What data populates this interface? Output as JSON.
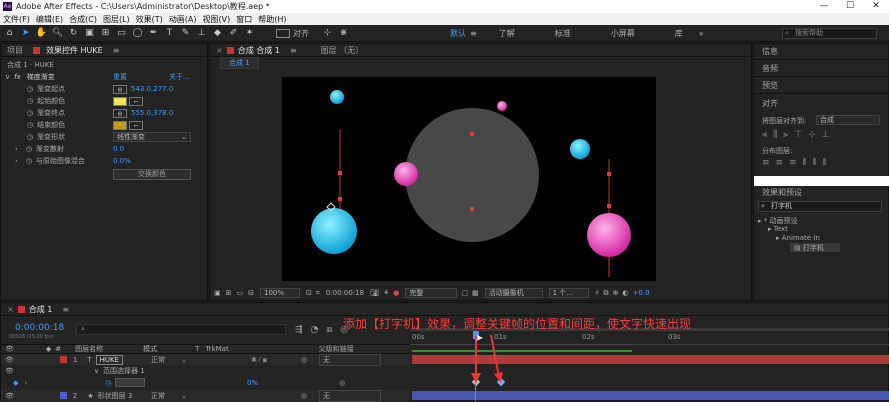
{
  "app": {
    "title": "Adobe After Effects - C:\\Users\\Administrator\\Desktop\\教程.aep *",
    "logo_text": "Ae"
  },
  "window_controls": [
    "—",
    "☐",
    "✕"
  ],
  "menu": [
    "文件(F)",
    "编辑(E)",
    "合成(C)",
    "图层(L)",
    "效果(T)",
    "动画(A)",
    "视图(V)",
    "窗口",
    "帮助(H)"
  ],
  "toolbar": {
    "align_label": "对齐",
    "workspaces": [
      "默认",
      "了解",
      "标准",
      "小屏幕",
      "库"
    ],
    "active_workspace": "默认",
    "search_placeholder": "搜索帮助"
  },
  "left_panel": {
    "tabs": [
      "项目",
      "效果控件 HUKE"
    ],
    "active_tab": "效果控件 HUKE",
    "breadcrumb": "合成 1 · HUKE",
    "effect": {
      "name": "梯度渐变",
      "reset": "重置",
      "about": "关于..."
    },
    "props": [
      {
        "label": "渐变起点",
        "value": "543.0,277.0",
        "kind": "point"
      },
      {
        "label": "起始颜色",
        "value": "",
        "kind": "color",
        "color": "#f6e05a"
      },
      {
        "label": "渐变终点",
        "value": "555.0,378.0",
        "kind": "point"
      },
      {
        "label": "结束颜色",
        "value": "",
        "kind": "color",
        "color": "#c89a20"
      },
      {
        "label": "渐变形状",
        "value": "线性渐变",
        "kind": "dropdown"
      },
      {
        "label": "渐变散射",
        "value": "0.0",
        "kind": "number"
      },
      {
        "label": "与原始图像混合",
        "value": "0.0%",
        "kind": "number"
      }
    ],
    "swap_button": "交换颜色"
  },
  "comp_panel": {
    "tabs": [
      "合成 合成 1",
      "图层 （无）"
    ],
    "crumb": "合成 1",
    "zoom": "100%",
    "timecode": "0:00:00:18",
    "quality": "完整",
    "camera": "活动摄像机",
    "views": "1 个...",
    "exposure": "+0.0"
  },
  "right_panel": {
    "info": "信息",
    "audio": "音频",
    "preview": "预览",
    "align": "对齐",
    "align_to_label": "将图层对齐到:",
    "align_to_value": "合成",
    "distribute": "分布图层:",
    "effects_title": "效果和预设",
    "effects_search": "打字机",
    "tree": [
      "* 动画预设",
      "Text",
      "Animate In",
      "打字机"
    ]
  },
  "timeline": {
    "tab": "合成 1",
    "timecode": "0:00:00:18",
    "fps": "00018 (25.00 fps)",
    "headers": [
      "图层名称",
      "模式",
      "T",
      "TrkMat",
      "父级和链接"
    ],
    "ruler": [
      "00s",
      "01s",
      "02s",
      "03s"
    ],
    "layers": [
      {
        "num": "1",
        "type_icon": "T",
        "name": "HUKE",
        "mode": "正常",
        "parent": "无",
        "color": "#c0392b"
      },
      {
        "num": "",
        "type_icon": "",
        "name": "范围选择器 1",
        "mode": "",
        "parent": "",
        "color": ""
      },
      {
        "num": "",
        "type_icon": "",
        "name": "",
        "mode": "",
        "parent": "0%",
        "color": ""
      },
      {
        "num": "2",
        "type_icon": "★",
        "name": "形状图层 3",
        "mode": "正常",
        "parent": "无",
        "color": "#4a63c9"
      }
    ],
    "annotation": "添加【打字机】效果，调整关键帧的位置和间距，使文字快速出现"
  }
}
